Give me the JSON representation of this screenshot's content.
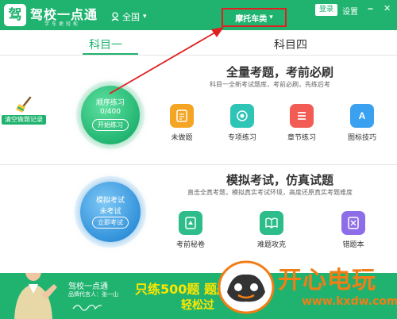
{
  "header": {
    "logo_char": "驾",
    "app_title": "驾校一点通",
    "app_subtitle": "学车更轻松",
    "region": "全国",
    "vehicle_type": "摩托车类",
    "login": "登录",
    "settings": "设置",
    "minimize": "−",
    "close": "✕"
  },
  "tabs": [
    {
      "label": "科目一",
      "active": true
    },
    {
      "label": "科目四",
      "active": false
    }
  ],
  "clear_records": {
    "label": "清空做题记录"
  },
  "section1": {
    "circle": {
      "title": "顺序练习",
      "progress": "0/400",
      "button": "开始练习"
    },
    "title": "全量考题，考前必刷",
    "subtitle": "科目一全新考试题库，考前必刷，先练后考",
    "features": [
      {
        "label": "未做题",
        "icon": "document-icon",
        "color": "#f5a524"
      },
      {
        "label": "专项练习",
        "icon": "target-icon",
        "color": "#2ec4b6"
      },
      {
        "label": "章节练习",
        "icon": "list-icon",
        "color": "#f25c54"
      },
      {
        "label": "图标技巧",
        "icon": "letter-a-icon",
        "color": "#3aa0f0"
      }
    ]
  },
  "section2": {
    "circle": {
      "title": "模拟考试",
      "status": "未考试",
      "button": "立即考试"
    },
    "title": "模拟考试，仿真试题",
    "subtitle": "直击全真考题，模拟真实考试环境，高度还原真实考题难度",
    "features": [
      {
        "label": "考前秘卷",
        "icon": "secret-paper-icon",
        "color": "#2dbd8a"
      },
      {
        "label": "难题攻克",
        "icon": "book-icon",
        "color": "#2dbd8a"
      },
      {
        "label": "错题本",
        "icon": "wrong-book-icon",
        "color": "#8e6ee8"
      }
    ]
  },
  "banner": {
    "brand": "驾校一点通",
    "spokesperson": "品牌代言人：张一山",
    "slogan1": "只练500题  题題",
    "slogan2": "轻松过"
  },
  "watermark": {
    "text": "开心电玩",
    "url": "www.kxdw.com"
  },
  "colors": {
    "primary": "#1fb36f",
    "highlight": "#e02020",
    "slogan": "#ffe600",
    "watermark": "#f07e17"
  }
}
